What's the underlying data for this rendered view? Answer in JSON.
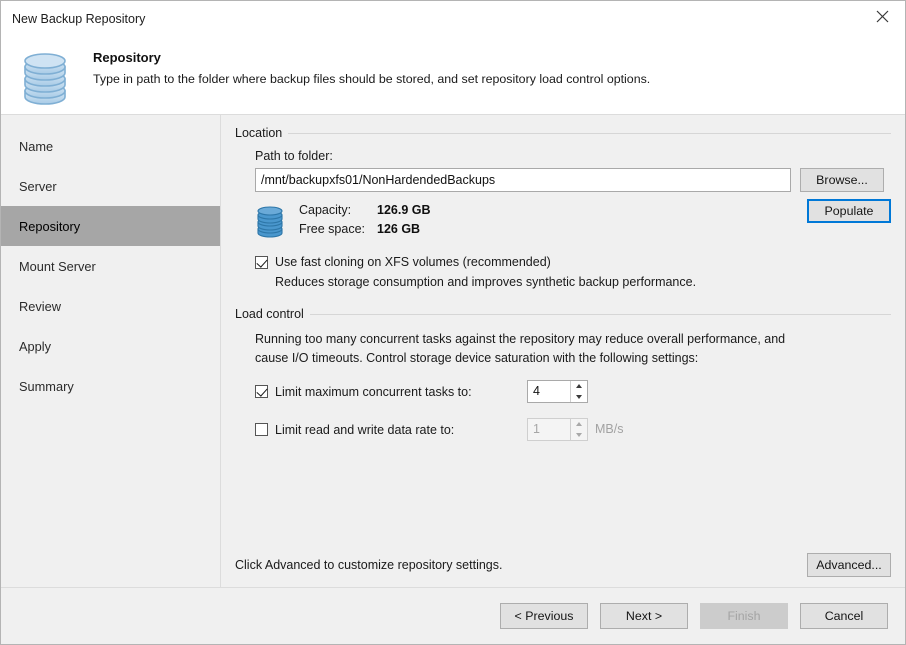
{
  "window": {
    "title": "New Backup Repository",
    "close_icon": "close-icon"
  },
  "header": {
    "icon": "repository-database-icon",
    "title": "Repository",
    "subtitle": "Type in path to the folder where backup files should be stored, and set repository load control options."
  },
  "sidebar": {
    "items": [
      {
        "label": "Name",
        "selected": false
      },
      {
        "label": "Server",
        "selected": false
      },
      {
        "label": "Repository",
        "selected": true
      },
      {
        "label": "Mount Server",
        "selected": false
      },
      {
        "label": "Review",
        "selected": false
      },
      {
        "label": "Apply",
        "selected": false
      },
      {
        "label": "Summary",
        "selected": false
      }
    ]
  },
  "location": {
    "group_title": "Location",
    "path_label": "Path to folder:",
    "path_value": "/mnt/backupxfs01/NonHardendedBackups",
    "path_placeholder": "",
    "browse_label": "Browse...",
    "populate_label": "Populate",
    "storage_icon": "database-icon",
    "capacity_label": "Capacity:",
    "capacity_value": "126.9 GB",
    "free_space_label": "Free space:",
    "free_space_value": "126 GB",
    "fast_clone_label": "Use fast cloning on XFS volumes (recommended)",
    "fast_clone_checked": true,
    "fast_clone_note": "Reduces storage consumption and improves synthetic backup performance."
  },
  "load_control": {
    "group_title": "Load control",
    "description_line1": "Running too many concurrent tasks against the repository may reduce overall performance, and",
    "description_line2": "cause I/O timeouts. Control storage device saturation with the following settings:",
    "limit_tasks_label": "Limit maximum concurrent tasks to:",
    "limit_tasks_checked": true,
    "limit_tasks_value": "4",
    "limit_rate_label": "Limit read and write data rate to:",
    "limit_rate_checked": false,
    "limit_rate_value": "1",
    "limit_rate_unit": "MB/s"
  },
  "advanced": {
    "note": "Click Advanced to customize repository settings.",
    "button_label": "Advanced..."
  },
  "footer": {
    "previous_label": "< Previous",
    "next_label": "Next >",
    "finish_label": "Finish",
    "finish_disabled": true,
    "cancel_label": "Cancel"
  },
  "colors": {
    "accent": "#0078d7",
    "selected_nav": "#a6a6a6",
    "dialog_bg": "#f0f0f0",
    "icon_blue": "#3c8dc5"
  }
}
